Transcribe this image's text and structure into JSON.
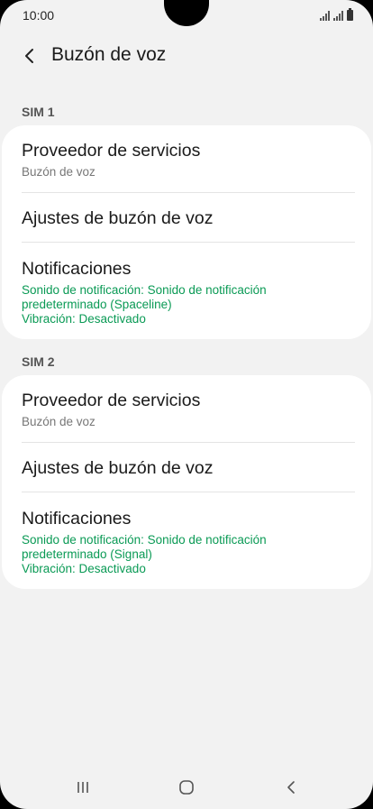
{
  "status": {
    "time": "10:00"
  },
  "header": {
    "title": "Buzón de voz"
  },
  "sims": [
    {
      "label": "SIM 1",
      "provider_title": "Proveedor de servicios",
      "provider_sub": "Buzón de voz",
      "settings_title": "Ajustes de buzón de voz",
      "notif_title": "Notificaciones",
      "notif_detail": "Sonido de notificación: Sonido de notificación predeterminado (Spaceline)",
      "notif_vibration": "Vibración: Desactivado"
    },
    {
      "label": "SIM 2",
      "provider_title": "Proveedor de servicios",
      "provider_sub": "Buzón de voz",
      "settings_title": "Ajustes de buzón de voz",
      "notif_title": "Notificaciones",
      "notif_detail": "Sonido de notificación: Sonido de notificación predeterminado (Signal)",
      "notif_vibration": "Vibración: Desactivado"
    }
  ],
  "icons": {
    "back": "chevron-left-icon",
    "recents": "recents-icon",
    "home": "home-icon",
    "nav_back": "nav-back-icon"
  },
  "colors": {
    "accent_green": "#0a9a55",
    "background": "#f2f2f2",
    "card": "#ffffff"
  }
}
